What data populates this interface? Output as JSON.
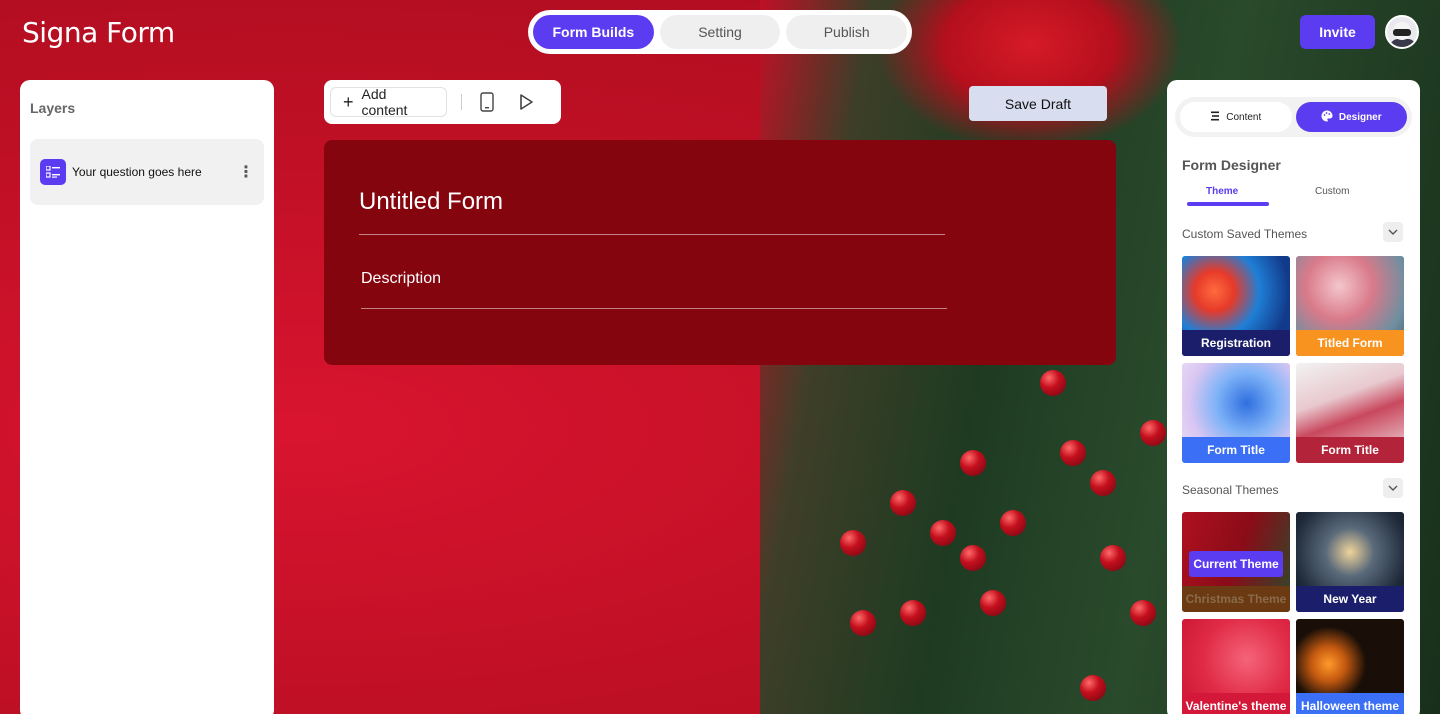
{
  "app": {
    "logo": "Signa Form"
  },
  "header": {
    "tabs": [
      {
        "label": "Form Builds",
        "active": true
      },
      {
        "label": "Setting",
        "active": false
      },
      {
        "label": "Publish",
        "active": false
      }
    ],
    "invite_label": "Invite",
    "accent": "#5b3cf0"
  },
  "layers": {
    "title": "Layers",
    "items": [
      {
        "label": "Your question goes here",
        "icon": "list-icon"
      }
    ]
  },
  "toolbar": {
    "add_label": "Add content",
    "icons": [
      "mobile-preview-icon",
      "play-icon"
    ],
    "save_draft_label": "Save Draft"
  },
  "form": {
    "title": "Untitled Form",
    "description": "Description",
    "background": "#85050f"
  },
  "designer": {
    "segments": [
      {
        "label": "Content",
        "icon": "content-icon",
        "active": false
      },
      {
        "label": "Designer",
        "icon": "palette-icon",
        "active": true
      }
    ],
    "title": "Form Designer",
    "sub_tabs": [
      {
        "label": "Theme",
        "active": true
      },
      {
        "label": "Custom",
        "active": false
      }
    ],
    "custom_saved": {
      "title": "Custom Saved Themes",
      "themes": [
        {
          "label": "Registration",
          "label_color": "#1b1f6b"
        },
        {
          "label": "Titled Form",
          "label_color": "#f7931e"
        },
        {
          "label": "Form Title",
          "label_color": "#3b6ff5"
        },
        {
          "label": "Form Title",
          "label_color": "#b3243a"
        }
      ]
    },
    "seasonal": {
      "title": "Seasonal Themes",
      "current_badge": "Current Theme",
      "themes": [
        {
          "label": "Christmas Theme",
          "label_color": "#6b3a12"
        },
        {
          "label": "New Year",
          "label_color": "#1b1f6b"
        },
        {
          "label": "Valentine's theme",
          "label_color": "#d4183a"
        },
        {
          "label": "Halloween theme",
          "label_color": "#3b6ff5"
        }
      ]
    }
  }
}
